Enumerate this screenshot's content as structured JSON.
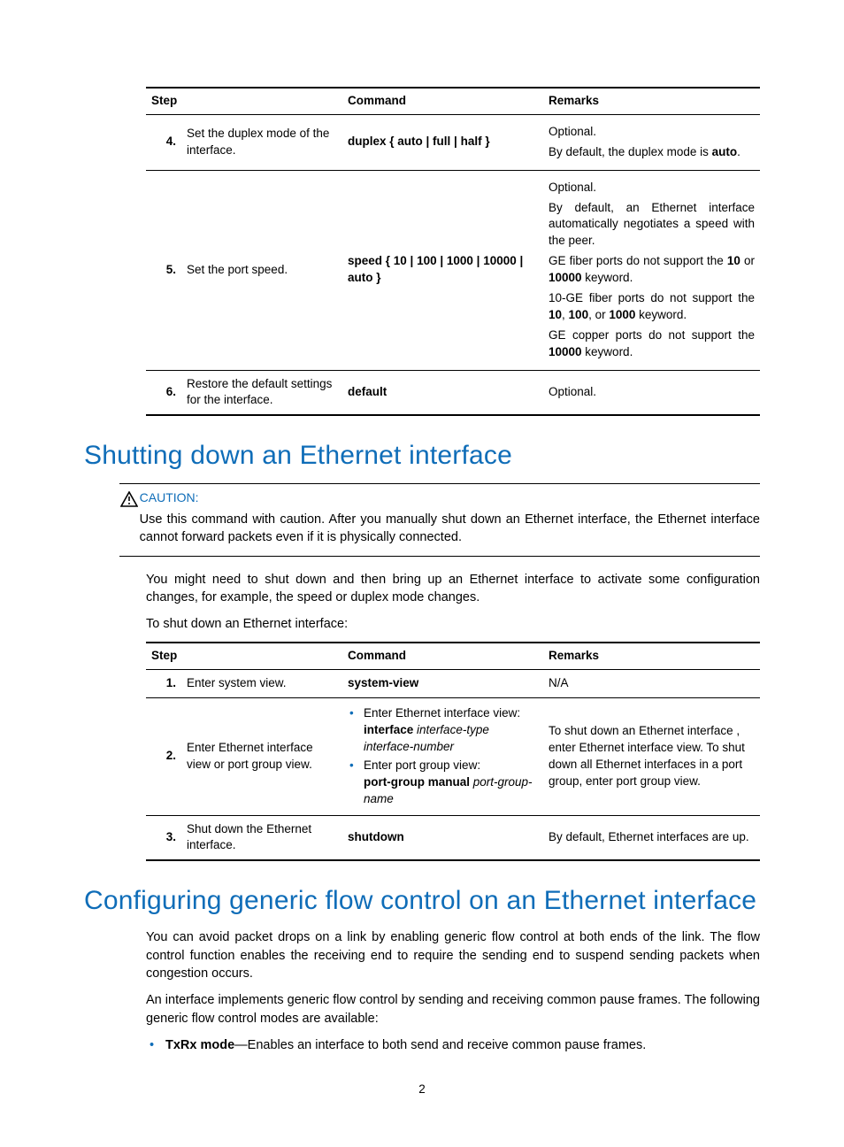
{
  "table1": {
    "headers": [
      "Step",
      "Command",
      "Remarks"
    ],
    "rows": [
      {
        "num": "4.",
        "desc": "Set the duplex mode of the interface.",
        "cmd_prefix": "duplex",
        "cmd_suffix": " { auto | full | half }",
        "remarks": [
          "Optional.",
          "By default, the duplex mode is <b>auto</b>."
        ]
      },
      {
        "num": "5.",
        "desc": "Set the port speed.",
        "cmd_prefix": "speed",
        "cmd_suffix": " { 10 | 100 | 1000 | 10000 | auto }",
        "remarks": [
          "Optional.",
          "By default, an Ethernet interface automatically negotiates a speed with the peer.",
          "GE fiber ports do not support the <b>10</b> or <b>10000</b> keyword.",
          "10-GE fiber ports do not support the <b>10</b>, <b>100</b>, or <b>1000</b> keyword.",
          "GE copper ports do not support the <b>10000</b> keyword."
        ]
      },
      {
        "num": "6.",
        "desc": "Restore the default settings for the interface.",
        "cmd_prefix": "default",
        "cmd_suffix": "",
        "remarks": [
          "Optional."
        ]
      }
    ]
  },
  "section1": {
    "heading": "Shutting down an Ethernet interface",
    "caution_label": "CAUTION:",
    "caution_text": "Use this command with caution. After you manually shut down an Ethernet interface, the Ethernet interface cannot forward packets even if it is physically connected.",
    "para1": "You might need to shut down and then bring up an Ethernet interface to activate some configuration changes, for example, the speed or duplex mode changes.",
    "para2": "To shut down an Ethernet interface:"
  },
  "table2": {
    "headers": [
      "Step",
      "Command",
      "Remarks"
    ],
    "rows": [
      {
        "num": "1.",
        "desc": "Enter system view.",
        "cmd_html": "<span class='b'>system-view</span>",
        "remarks": "N/A"
      },
      {
        "num": "2.",
        "desc": "Enter Ethernet interface view or port group view.",
        "cmd_list": [
          "Enter Ethernet interface view:<br><span class='b'>interface</span> <span class='it'>interface-type interface-number</span>",
          "Enter port group view:<br><span class='b'>port-group manual</span> <span class='it'>port-group-name</span>"
        ],
        "remarks": "To shut down an Ethernet interface , enter Ethernet interface view. To shut down all Ethernet interfaces in a port group, enter port group view."
      },
      {
        "num": "3.",
        "desc": "Shut down the Ethernet interface.",
        "cmd_html": "<span class='b'>shutdown</span>",
        "remarks": "By default, Ethernet interfaces are up."
      }
    ]
  },
  "section2": {
    "heading": "Configuring generic flow control on an Ethernet interface",
    "para1": "You can avoid packet drops on a link by enabling generic flow control at both ends of the link. The flow control function enables the receiving end to require the sending end to suspend sending packets when congestion occurs.",
    "para2": "An interface implements generic flow control by sending and receiving common pause frames. The following generic flow control modes are available:",
    "bullet1_label": "TxRx mode",
    "bullet1_text": "—Enables an interface to both send and receive common pause frames."
  },
  "page_number": "2"
}
